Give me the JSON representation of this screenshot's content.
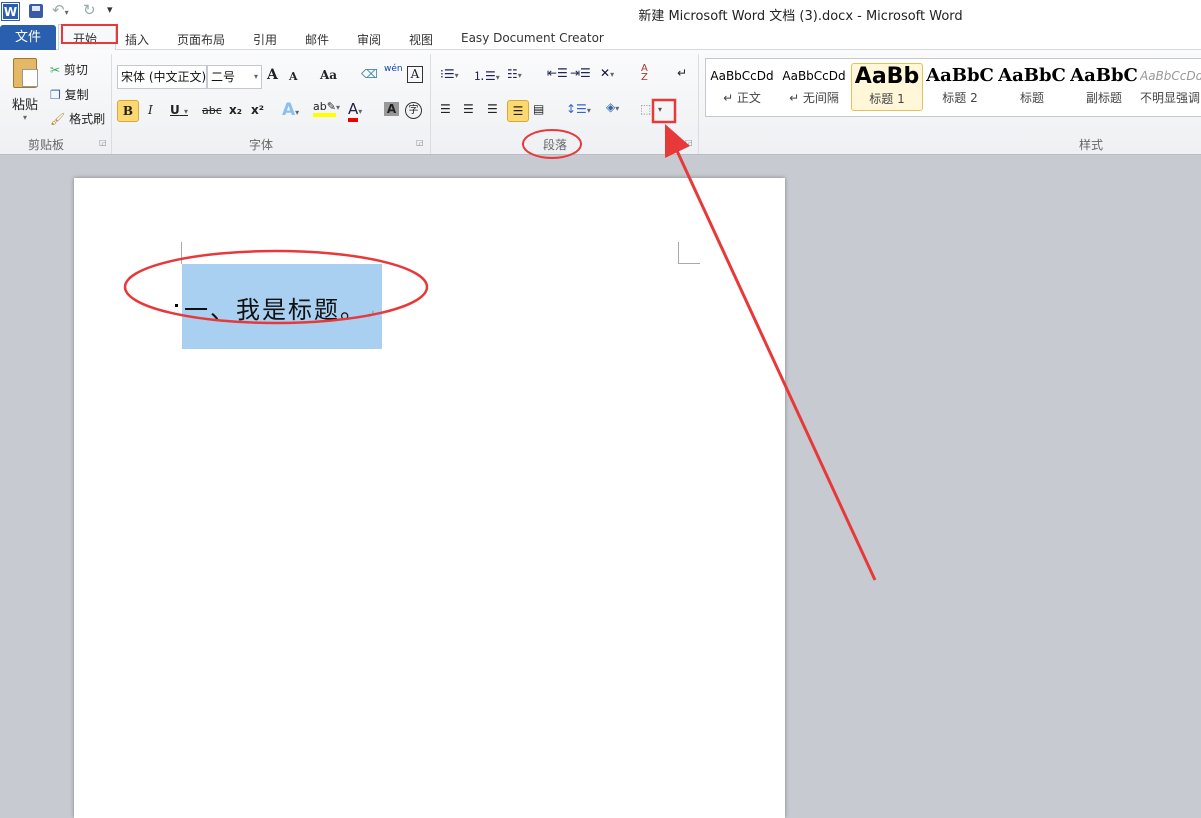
{
  "window": {
    "title": "新建 Microsoft Word 文档 (3).docx  -  Microsoft Word"
  },
  "qat": {
    "app_icon": "word-icon",
    "save": "save-icon",
    "undo": "undo-icon",
    "redo": "redo-icon",
    "customize": "customize-icon"
  },
  "tabs": [
    {
      "label": "文件"
    },
    {
      "label": "开始"
    },
    {
      "label": "插入"
    },
    {
      "label": "页面布局"
    },
    {
      "label": "引用"
    },
    {
      "label": "邮件"
    },
    {
      "label": "审阅"
    },
    {
      "label": "视图"
    },
    {
      "label": "Easy Document Creator"
    }
  ],
  "clipboard": {
    "paste": "粘贴",
    "cut": "剪切",
    "copy": "复制",
    "format_painter": "格式刷",
    "label": "剪贴板"
  },
  "font": {
    "name": "宋体 (中文正文)",
    "size": "二号",
    "label": "字体",
    "grow": "A",
    "shrink": "A",
    "case": "Aa",
    "bold": "B",
    "italic": "I",
    "underline": "U",
    "strike": "abc",
    "sub": "x₂",
    "sup": "x²",
    "color_letter": "A",
    "char_border": "A",
    "enclose": "字",
    "phonetic": "wén"
  },
  "paragraph": {
    "label": "段落"
  },
  "styles": {
    "label": "样式",
    "items": [
      {
        "preview": "AaBbCcDd",
        "name": "↵ 正文"
      },
      {
        "preview": "AaBbCcDd",
        "name": "↵ 无间隔"
      },
      {
        "preview": "AaBb",
        "name": "标题 1",
        "selected": true
      },
      {
        "preview": "AaBbC",
        "name": "标题 2"
      },
      {
        "preview": "AaBbC",
        "name": "标题"
      },
      {
        "preview": "AaBbC",
        "name": "副标题"
      },
      {
        "preview": "AaBbCcDd",
        "name": "不明显强调"
      }
    ]
  },
  "document": {
    "heading": "一、我是标题。",
    "paragraph_mark": "↵"
  },
  "colors": {
    "accent": "#2a5faf",
    "annotation": "#e8393a",
    "selection": "#a9cff1",
    "highlight": "#ffff00",
    "font_color": "#ff0000"
  }
}
